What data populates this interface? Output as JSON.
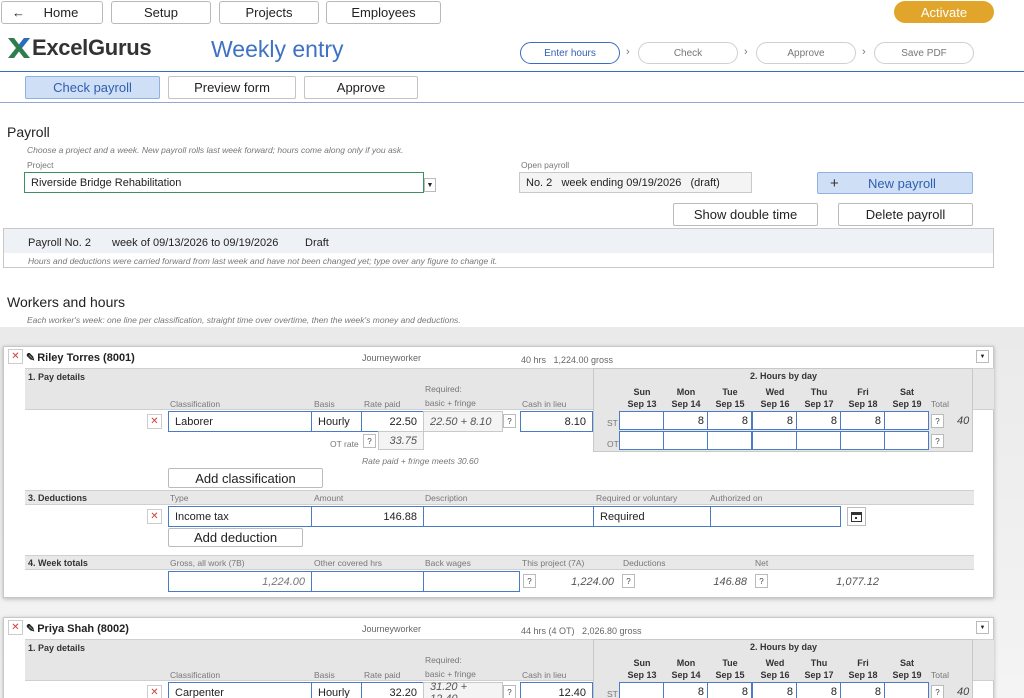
{
  "top_nav": {
    "home": "Home",
    "setup": "Setup",
    "projects": "Projects",
    "employees": "Employees",
    "activate": "Activate"
  },
  "brand": {
    "logo_text": "ExcelGurus",
    "title": "Weekly entry"
  },
  "steps": [
    "Enter hours",
    "Check",
    "Approve",
    "Save PDF"
  ],
  "tabs": [
    "Check payroll",
    "Preview form",
    "Approve"
  ],
  "payroll_section": {
    "heading": "Payroll",
    "hint": "Choose a project and a week. New payroll rolls last week forward; hours come along only if you ask.",
    "project_label": "Project",
    "project_value": "Riverside Bridge Rehabilitation",
    "open_payroll_label": "Open payroll",
    "open_payroll_value": "No. 2   week ending 09/19/2026   (draft)",
    "new_payroll": "New payroll",
    "show_double_time": "Show double time",
    "delete_payroll": "Delete payroll",
    "summary": {
      "number": "Payroll No. 2",
      "week": "week of 09/13/2026 to 09/19/2026",
      "status": "Draft"
    },
    "summary_hint": "Hours and deductions were carried forward from last week and have not been changed yet; type over any figure to change it."
  },
  "workers_section": {
    "heading": "Workers and hours",
    "hint": "Each worker's week: one line per classification, straight time over overtime, then the week's money and deductions."
  },
  "labels": {
    "pay_details": "1. Pay details",
    "hours_by_day": "2. Hours by day",
    "deductions": "3. Deductions",
    "week_totals": "4. Week totals",
    "classification": "Classification",
    "basis": "Basis",
    "rate_paid": "Rate paid",
    "required": "Required:",
    "basic_fringe": "basic + fringe",
    "cash_in_lieu": "Cash in lieu",
    "total": "Total",
    "ot_rate": "OT rate",
    "st": "ST",
    "ot": "OT",
    "add_classification": "Add classification",
    "type": "Type",
    "amount": "Amount",
    "description": "Description",
    "req_or_vol": "Required or voluntary",
    "authorized_on": "Authorized on",
    "add_deduction": "Add deduction",
    "gross_all": "Gross, all work (7B)",
    "other_hrs": "Other covered hrs",
    "back_wages": "Back wages",
    "this_project": "This project (7A)",
    "deductions_col": "Deductions",
    "net": "Net",
    "q": "?"
  },
  "days": [
    {
      "name": "Sun",
      "date": "Sep 13"
    },
    {
      "name": "Mon",
      "date": "Sep 14"
    },
    {
      "name": "Tue",
      "date": "Sep 15"
    },
    {
      "name": "Wed",
      "date": "Sep 16"
    },
    {
      "name": "Thu",
      "date": "Sep 17"
    },
    {
      "name": "Fri",
      "date": "Sep 18"
    },
    {
      "name": "Sat",
      "date": "Sep 19"
    }
  ],
  "workers": [
    {
      "name": "Riley Torres (8001)",
      "craft": "Journeyworker",
      "summary": "40 hrs   1,224.00 gross",
      "classification": "Laborer",
      "basis": "Hourly",
      "rate_paid": "22.50",
      "required": "22.50 + 8.10",
      "cash_in_lieu": "8.10",
      "ot_rate": "33.75",
      "rate_note": "Rate paid + fringe meets 30.60",
      "st_hours": [
        "",
        "8",
        "8",
        "8",
        "8",
        "8",
        ""
      ],
      "st_total": "40",
      "deduction": {
        "type": "Income tax",
        "amount": "146.88",
        "description": "",
        "required": "Required",
        "authorized": ""
      },
      "totals": {
        "gross": "1,224.00",
        "other_hrs": "",
        "back_wages": "",
        "this_project": "1,224.00",
        "deductions": "146.88",
        "net": "1,077.12"
      }
    },
    {
      "name": "Priya Shah (8002)",
      "craft": "Journeyworker",
      "summary": "44 hrs (4 OT)   2,026.80 gross",
      "classification": "Carpenter",
      "basis": "Hourly",
      "rate_paid": "32.20",
      "required": "31.20 + 12.40",
      "cash_in_lieu": "12.40",
      "st_hours": [
        "",
        "8",
        "8",
        "8",
        "8",
        "8",
        ""
      ],
      "st_total": "40"
    }
  ]
}
